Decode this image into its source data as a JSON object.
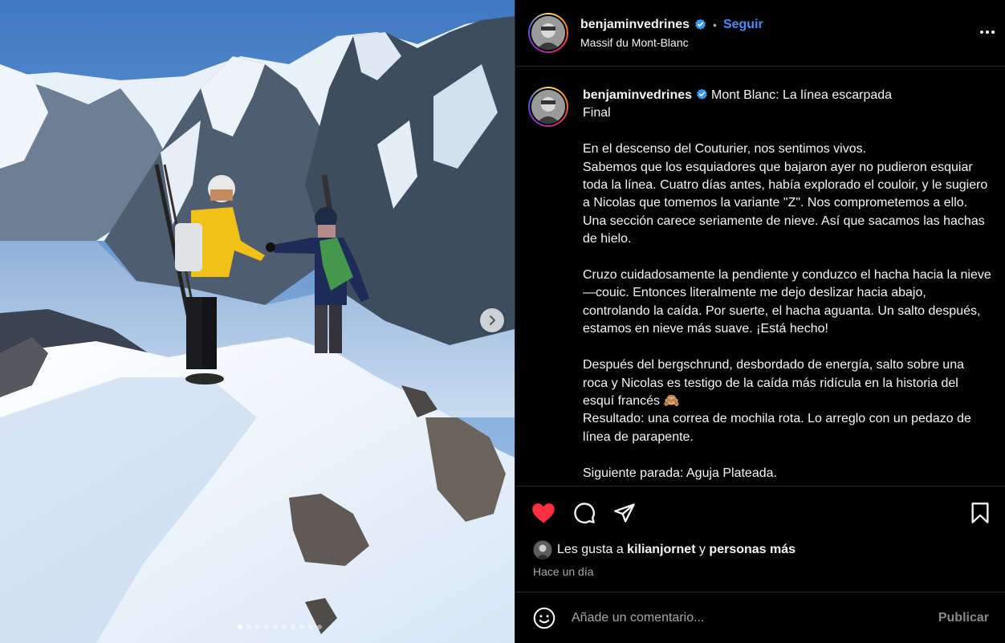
{
  "post": {
    "username": "benjaminvedrines",
    "verified": true,
    "separator": "•",
    "follow_label": "Seguir",
    "location": "Massif du Mont-Blanc"
  },
  "caption": {
    "username": "benjaminvedrines",
    "text": "Mont Blanc: La línea escarpada\nFinal\n\nEn el descenso del Couturier, nos sentimos vivos.\nSabemos que los esquiadores que bajaron ayer no pudieron esquiar toda la línea. Cuatro días antes, había explorado el couloir, y le sugiero a Nicolas que tomemos la variante \"Z\". Nos comprometemos a ello. Una sección carece seriamente de nieve. Así que sacamos las hachas de hielo.\n\nCruzo cuidadosamente la pendiente y conduzco el hacha hacia la nieve—couic. Entonces literalmente me dejo deslizar hacia abajo, controlando la caída. Por suerte, el hacha aguanta. Un salto después, estamos en nieve más suave. ¡Está hecho!\n\nDespués del bergschrund, desbordado de energía, salto sobre una roca y Nicolas es testigo de la caída más ridícula en la historia del esquí francés 🙈\nResultado: una correa de mochila rota. Lo arreglo con un pedazo de línea de parapente.\n\nSiguiente parada: Aguja Plateada."
  },
  "carousel": {
    "total_slides": 10,
    "active_index": 0,
    "next_icon": "chevron-right-icon"
  },
  "actions": {
    "like_icon": "heart-filled-icon",
    "like_color": "#ff3040",
    "comment_icon": "comment-icon",
    "share_icon": "share-icon",
    "save_icon": "bookmark-icon"
  },
  "likes": {
    "prefix": "Les gusta a ",
    "user": "kilianjornet",
    "connector": " y ",
    "others": "personas más"
  },
  "timestamp": "Hace un día",
  "comment": {
    "placeholder": "Añade un comentario...",
    "publish_label": "Publicar",
    "emoji_icon": "emoji-icon"
  },
  "colors": {
    "background": "#000000",
    "link_blue": "#4a8cf7",
    "verified_blue": "#3897f0",
    "muted": "#a8a8a8",
    "divider": "#262626"
  }
}
